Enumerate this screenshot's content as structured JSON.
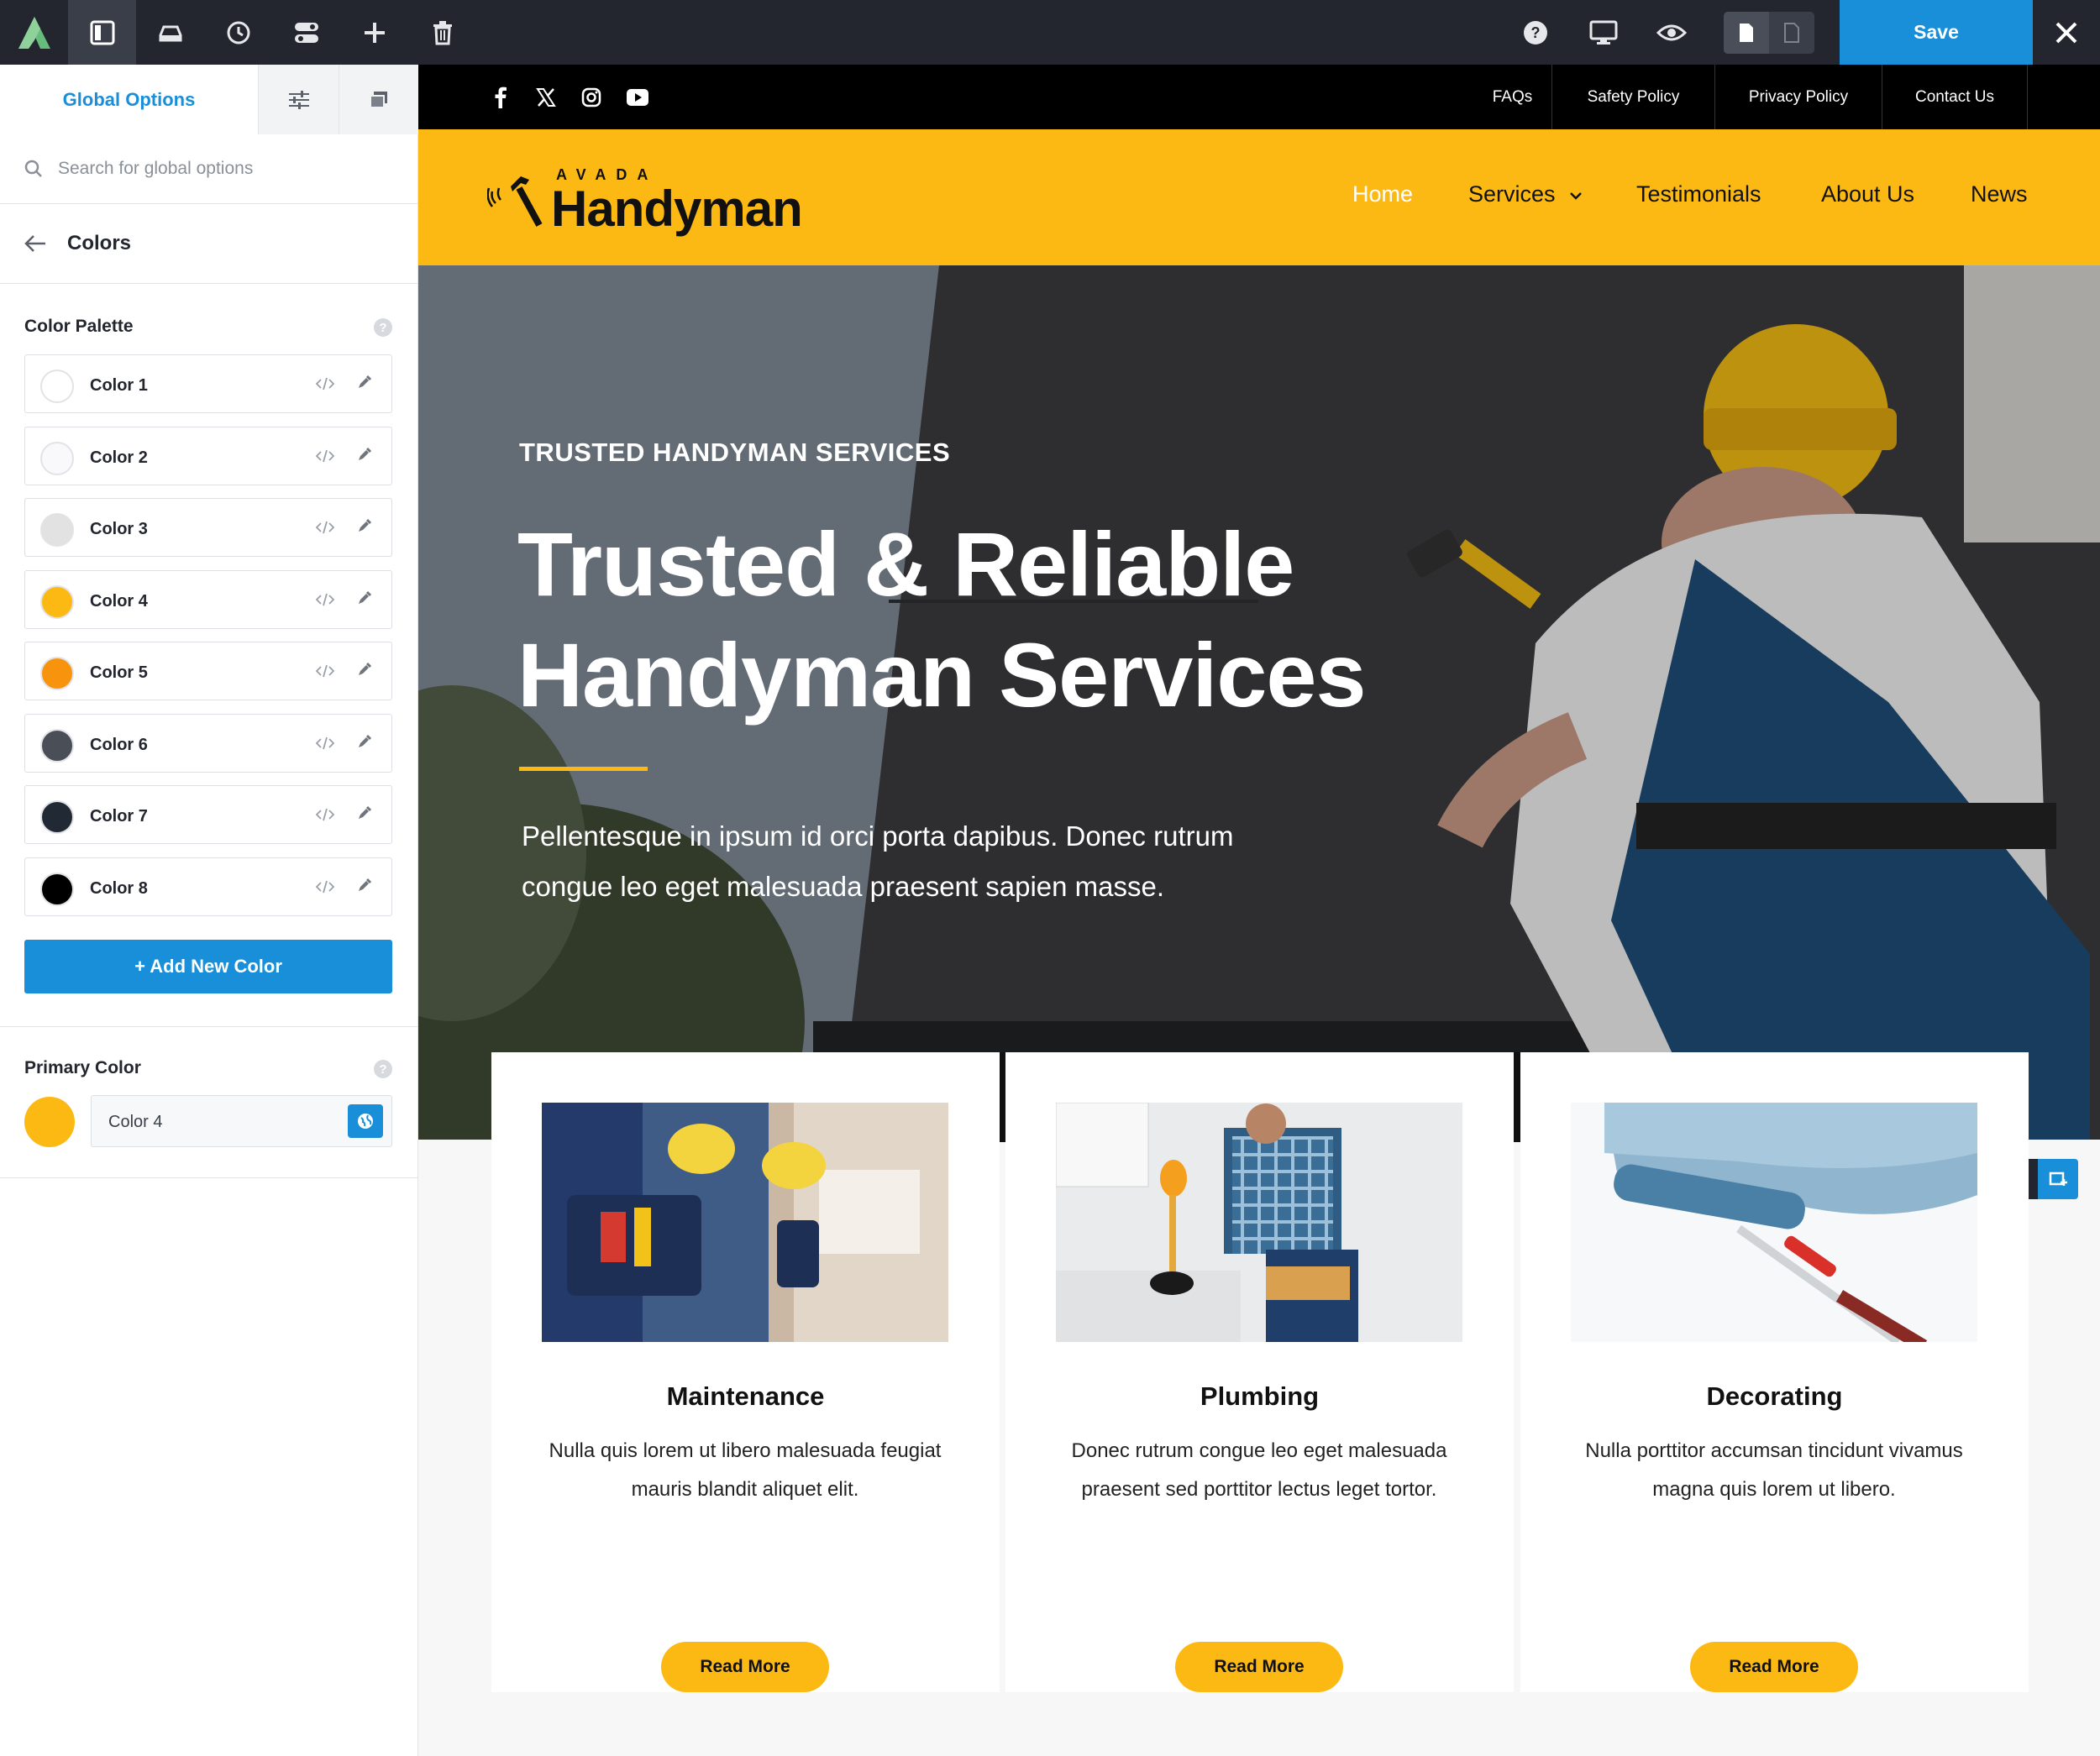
{
  "toolbar": {
    "save_label": "Save"
  },
  "panel": {
    "tabs": {
      "global_options": "Global Options"
    },
    "search": {
      "placeholder": "Search for global options"
    },
    "breadcrumb": "Colors",
    "palette_label": "Color Palette",
    "colors": [
      {
        "name": "Color 1",
        "hex": "#ffffff"
      },
      {
        "name": "Color 2",
        "hex": "#f9f9fb"
      },
      {
        "name": "Color 3",
        "hex": "#e2e2e2"
      },
      {
        "name": "Color 4",
        "hex": "#fdb913"
      },
      {
        "name": "Color 5",
        "hex": "#f7930d"
      },
      {
        "name": "Color 6",
        "hex": "#4a4e57"
      },
      {
        "name": "Color 7",
        "hex": "#212934"
      },
      {
        "name": "Color 8",
        "hex": "#000000"
      }
    ],
    "add_color_label": "+ Add New Color",
    "primary_label": "Primary Color",
    "primary_value": "Color 4"
  },
  "site": {
    "top_links": [
      "FAQs",
      "Safety Policy",
      "Privacy Policy",
      "Contact Us"
    ],
    "logo": {
      "small": "AVADA",
      "big": "Handyman"
    },
    "nav": [
      "Home",
      "Services",
      "Testimonials",
      "About Us",
      "News"
    ],
    "hero": {
      "kicker": "TRUSTED HANDYMAN SERVICES",
      "title_line1": "Trusted & Reliable",
      "title_line2": "Handyman Services",
      "text": "Pellentesque in ipsum id orci porta dapibus. Donec rutrum congue leo eget malesuada praesent sapien masse."
    },
    "cards": [
      {
        "title": "Maintenance",
        "text": "Nulla quis lorem ut libero malesuada feugiat mauris blandit aliquet elit.",
        "button": "Read More"
      },
      {
        "title": "Plumbing",
        "text": "Donec rutrum congue leo eget malesuada praesent sed porttitor lectus leget tortor.",
        "button": "Read More"
      },
      {
        "title": "Decorating",
        "text": "Nulla porttitor accumsan tincidunt vivamus magna quis lorem ut libero.",
        "button": "Read More"
      }
    ]
  },
  "colors": {
    "accent_blue": "#198fd9",
    "brand_yellow": "#fdb913",
    "toolbar_dark": "#23262e"
  }
}
